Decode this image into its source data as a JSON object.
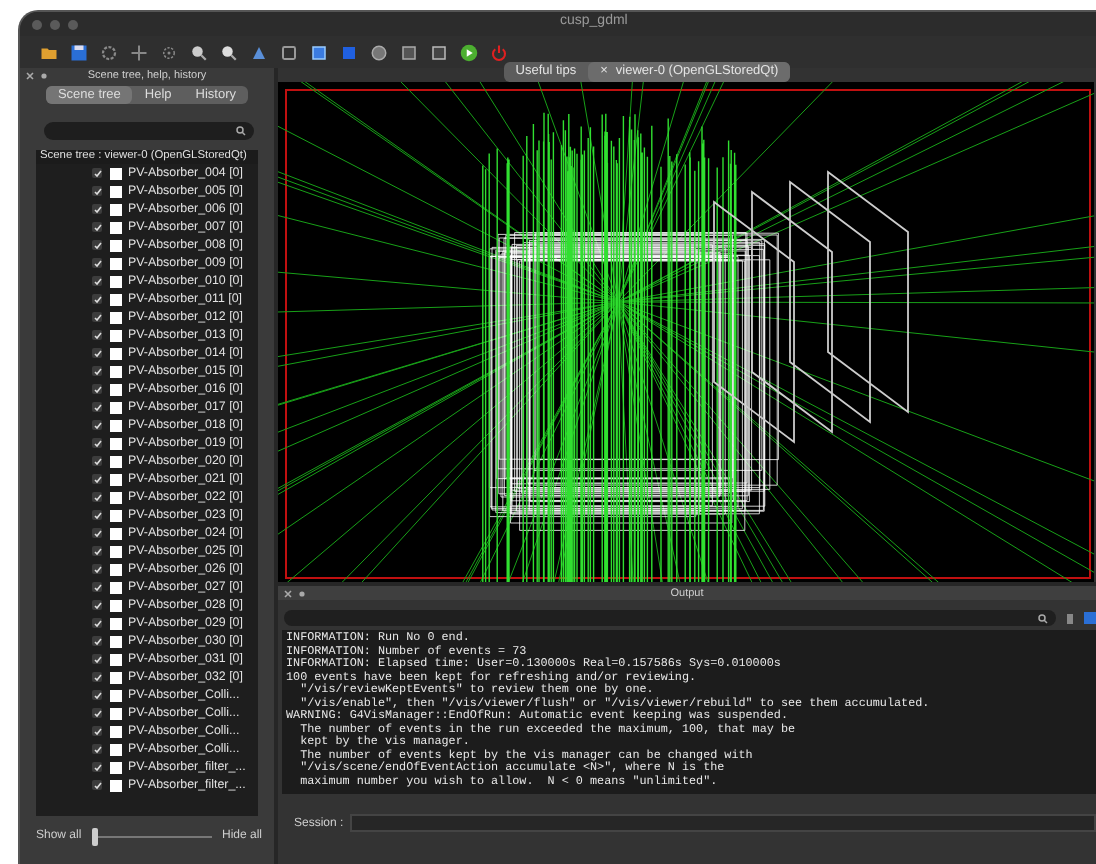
{
  "window": {
    "title": "cusp_gdml"
  },
  "scene_dock": {
    "title": "Scene tree, help, history",
    "tabs": [
      {
        "label": "Scene tree",
        "selected": true
      },
      {
        "label": "Help",
        "selected": false
      },
      {
        "label": "History",
        "selected": false
      }
    ],
    "tree_header": "Scene tree : viewer-0 (OpenGLStoredQt)",
    "items": [
      {
        "label": "PV-Absorber_004 [0]",
        "checked": true
      },
      {
        "label": "PV-Absorber_005 [0]",
        "checked": true
      },
      {
        "label": "PV-Absorber_006 [0]",
        "checked": true
      },
      {
        "label": "PV-Absorber_007 [0]",
        "checked": true
      },
      {
        "label": "PV-Absorber_008 [0]",
        "checked": true
      },
      {
        "label": "PV-Absorber_009 [0]",
        "checked": true
      },
      {
        "label": "PV-Absorber_010 [0]",
        "checked": true
      },
      {
        "label": "PV-Absorber_011 [0]",
        "checked": true
      },
      {
        "label": "PV-Absorber_012 [0]",
        "checked": true
      },
      {
        "label": "PV-Absorber_013 [0]",
        "checked": true
      },
      {
        "label": "PV-Absorber_014 [0]",
        "checked": true
      },
      {
        "label": "PV-Absorber_015 [0]",
        "checked": true
      },
      {
        "label": "PV-Absorber_016 [0]",
        "checked": true
      },
      {
        "label": "PV-Absorber_017 [0]",
        "checked": true
      },
      {
        "label": "PV-Absorber_018 [0]",
        "checked": true
      },
      {
        "label": "PV-Absorber_019 [0]",
        "checked": true
      },
      {
        "label": "PV-Absorber_020 [0]",
        "checked": true
      },
      {
        "label": "PV-Absorber_021 [0]",
        "checked": true
      },
      {
        "label": "PV-Absorber_022 [0]",
        "checked": true
      },
      {
        "label": "PV-Absorber_023 [0]",
        "checked": true
      },
      {
        "label": "PV-Absorber_024 [0]",
        "checked": true
      },
      {
        "label": "PV-Absorber_025 [0]",
        "checked": true
      },
      {
        "label": "PV-Absorber_026 [0]",
        "checked": true
      },
      {
        "label": "PV-Absorber_027 [0]",
        "checked": true
      },
      {
        "label": "PV-Absorber_028 [0]",
        "checked": true
      },
      {
        "label": "PV-Absorber_029 [0]",
        "checked": true
      },
      {
        "label": "PV-Absorber_030 [0]",
        "checked": true
      },
      {
        "label": "PV-Absorber_031 [0]",
        "checked": true
      },
      {
        "label": "PV-Absorber_032 [0]",
        "checked": true
      },
      {
        "label": "PV-Absorber_Colli...",
        "checked": true
      },
      {
        "label": "PV-Absorber_Colli...",
        "checked": true
      },
      {
        "label": "PV-Absorber_Colli...",
        "checked": true
      },
      {
        "label": "PV-Absorber_Colli...",
        "checked": true
      },
      {
        "label": "PV-Absorber_filter_...",
        "checked": true
      },
      {
        "label": "PV-Absorber_filter_...",
        "checked": true
      }
    ],
    "show_all": "Show all",
    "hide_all": "Hide all",
    "slider": {
      "level": 0
    }
  },
  "viewer_tabs": [
    {
      "label": "Useful tips",
      "selected": false
    },
    {
      "label": "viewer-0 (OpenGLStoredQt)",
      "selected": true,
      "close": "×"
    }
  ],
  "output": {
    "title": "Output",
    "lines": [
      "INFORMATION: Run No 0 end.",
      "INFORMATION: Number of events = 73",
      "INFORMATION: Elapsed time: User=0.130000s Real=0.157586s Sys=0.010000s",
      "100 events have been kept for refreshing and/or reviewing.",
      "  \"/vis/reviewKeptEvents\" to review them one by one.",
      "  \"/vis/enable\", then \"/vis/viewer/flush\" or \"/vis/viewer/rebuild\" to see them accumulated.",
      "WARNING: G4VisManager::EndOfRun: Automatic event keeping was suspended.",
      "  The number of events in the run exceeded the maximum, 100, that may be",
      "  kept by the vis manager.",
      "  The number of events kept by the vis manager can be changed with",
      "  \"/vis/scene/endOfEventAction accumulate <N>\", where N is the",
      "  maximum number you wish to allow.  N < 0 means \"unlimited\"."
    ],
    "session_label": "Session :"
  }
}
